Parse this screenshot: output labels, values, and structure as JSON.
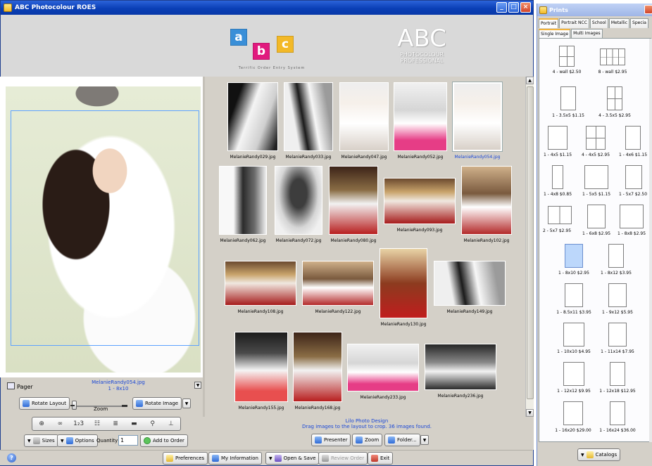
{
  "main_window": {
    "title": "ABC Photocolour ROES",
    "logo_letters": [
      "a",
      "b",
      "c"
    ],
    "logo_tagline": "Terrific Order Entry System",
    "logo_pro_big": "ABC",
    "logo_pro_line1": "PHOTOCOLOUR",
    "logo_pro_line2": "PROFESSIONAL"
  },
  "pager": {
    "label": "Pager",
    "file_name": "MelanieRandy054.jpg",
    "file_size": "1 - 8x10"
  },
  "controls": {
    "rotate_layout": "Rotate Layout",
    "zoom_label": "Zoom",
    "zoom_level": 0,
    "rotate_image": "Rotate Image",
    "sizes": "Sizes",
    "options": "Options",
    "quantity_label": "Quantity",
    "quantity_value": "1",
    "add_to_order": "Add to Order",
    "tool_icons": [
      "crop-icon",
      "link-icon",
      "numbering-icon",
      "grid-icon",
      "layers-icon",
      "fill-icon",
      "magnify-icon",
      "pin-icon"
    ]
  },
  "thumbnails": [
    {
      "name": "MelanieRandy029.jpg",
      "style": "bw1",
      "selected": false
    },
    {
      "name": "MelanieRandy033.jpg",
      "style": "bw2",
      "selected": false
    },
    {
      "name": "MelanieRandy047.jpg",
      "style": "col1",
      "selected": false
    },
    {
      "name": "MelanieRandy052.jpg",
      "style": "col7",
      "selected": false
    },
    {
      "name": "MelanieRandy054.jpg",
      "style": "col1",
      "selected": true
    },
    {
      "name": "MelanieRandy062.jpg",
      "style": "bw4",
      "selected": false
    },
    {
      "name": "MelanieRandy072.jpg",
      "style": "bw3",
      "selected": false
    },
    {
      "name": "MelanieRandy080.jpg",
      "style": "col2",
      "selected": false
    },
    {
      "name": "MelanieRandy093.jpg",
      "style": "col3",
      "selected": false
    },
    {
      "name": "MelanieRandy102.jpg",
      "style": "col4",
      "selected": false
    },
    {
      "name": "MelanieRandy108.jpg",
      "style": "col3",
      "selected": false
    },
    {
      "name": "MelanieRandy122.jpg",
      "style": "col4",
      "selected": false
    },
    {
      "name": "MelanieRandy130.jpg",
      "style": "col5",
      "selected": false
    },
    {
      "name": "MelanieRandy149.jpg",
      "style": "bw2",
      "selected": false
    },
    {
      "name": "MelanieRandy155.jpg",
      "style": "col6",
      "selected": false
    },
    {
      "name": "MelanieRandy168.jpg",
      "style": "col2",
      "selected": false
    },
    {
      "name": "MelanieRandy233.jpg",
      "style": "col7",
      "selected": false
    },
    {
      "name": "MelanieRandy236.jpg",
      "style": "col8",
      "selected": false
    }
  ],
  "status": {
    "line1": "Lilo Photo Design",
    "line2": "Drag images to the layout to crop. 36 images found.",
    "presenter": "Presenter",
    "zoom": "Zoom",
    "folder": "Folder..."
  },
  "bottom_bar": {
    "preferences": "Preferences",
    "my_information": "My Information",
    "open_save": "Open & Save",
    "review_order": "Review Order",
    "exit": "Exit"
  },
  "prints_window": {
    "title": "Prints",
    "tabs": [
      "Portrait",
      "Portrait NCC",
      "School",
      "Metallic",
      "Specia"
    ],
    "active_tab": "Portrait",
    "subtabs": [
      "Single Image",
      "Multi Images"
    ],
    "active_subtab": "Single Image",
    "sizes": [
      {
        "label": "4 - wall $2.50",
        "type": "grid4"
      },
      {
        "label": "8 - wall $2.95",
        "type": "grid8"
      },
      {
        "label": "1 - 3.5x5 $1.15",
        "type": "plain"
      },
      {
        "label": "4 - 3.5x5 $2.95",
        "type": "grid4"
      },
      {
        "label": "1 - 4x5 $1.15",
        "type": "plain"
      },
      {
        "label": "4 - 4x5 $2.95",
        "type": "grid4"
      },
      {
        "label": "1 - 4x6 $1.15",
        "type": "plain"
      },
      {
        "label": "1 - 4x8 $0.85",
        "type": "plain"
      },
      {
        "label": "1 - 5x5 $1.15",
        "type": "plain"
      },
      {
        "label": "1 - 5x7 $2.50",
        "type": "plain"
      },
      {
        "label": "2 - 5x7 $2.95",
        "type": "split2"
      },
      {
        "label": "1 - 6x8 $2.95",
        "type": "plain"
      },
      {
        "label": "1 - 8x8 $2.95",
        "type": "plain"
      },
      {
        "label": "1 - 8x10 $2.95",
        "type": "selected"
      },
      {
        "label": "1 - 8x12 $3.95",
        "type": "plain"
      },
      {
        "label": "1 - 8.5x11 $3.95",
        "type": "plain"
      },
      {
        "label": "1 - 9x12 $5.95",
        "type": "plain"
      },
      {
        "label": "1 - 10x10 $4.95",
        "type": "plain"
      },
      {
        "label": "1 - 11x14 $7.95",
        "type": "plain"
      },
      {
        "label": "1 - 12x12 $9.95",
        "type": "plain"
      },
      {
        "label": "1 - 12x18 $12.95",
        "type": "plain"
      },
      {
        "label": "1 - 16x20 $29.00",
        "type": "plain"
      },
      {
        "label": "1 - 16x24 $36.00",
        "type": "plain"
      }
    ],
    "catalogs": "Catalogs"
  }
}
